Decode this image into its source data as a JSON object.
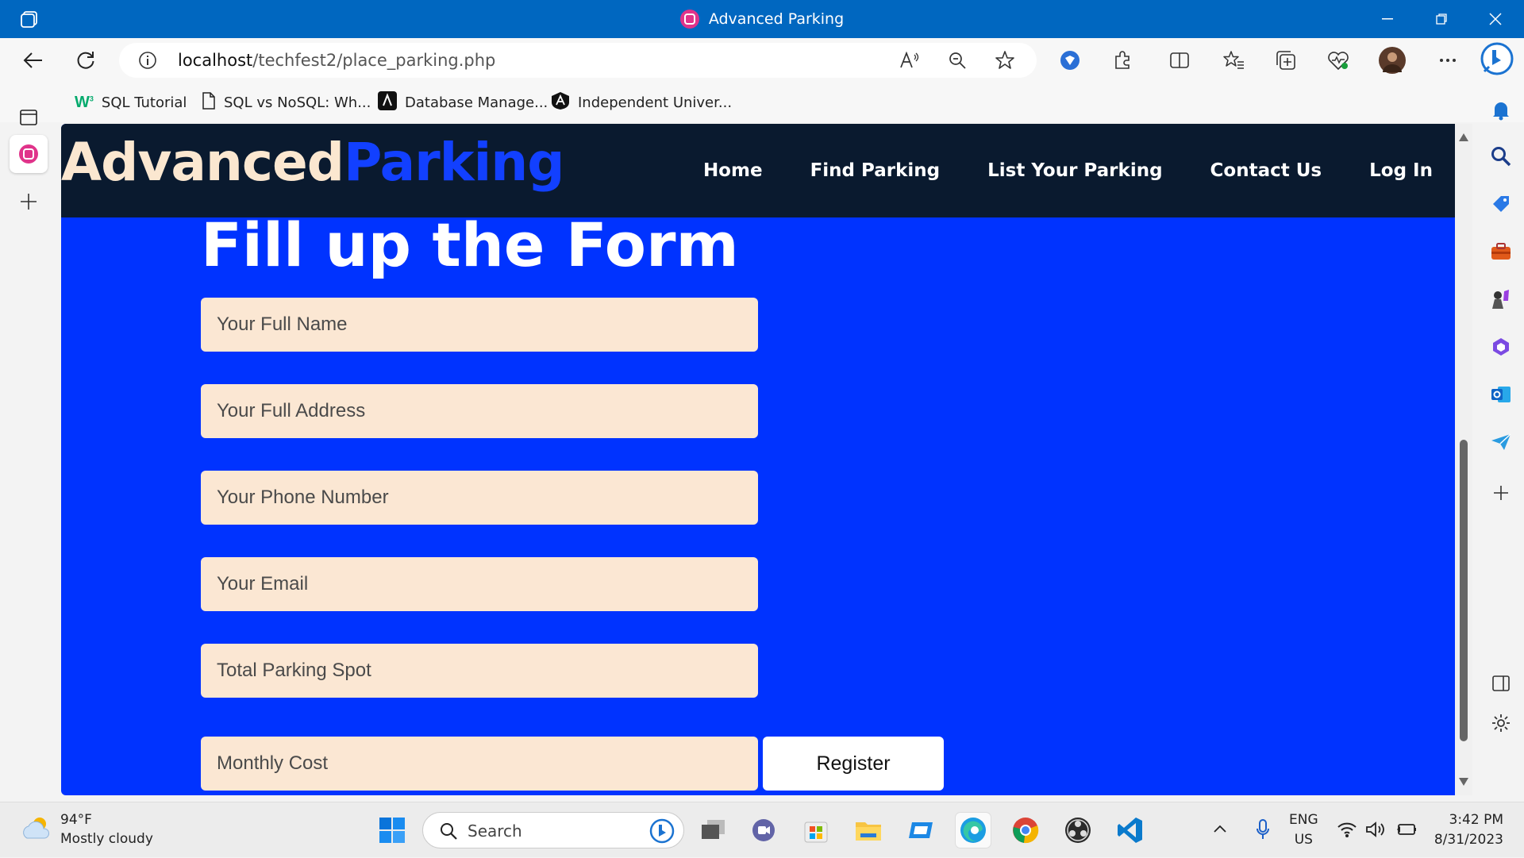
{
  "browser": {
    "window_title": "Advanced Parking",
    "url_host": "localhost",
    "url_path": "/techfest2/place_parking.php",
    "favorites": [
      {
        "label": "SQL Tutorial",
        "icon": "w3schools-icon"
      },
      {
        "label": "SQL vs NoSQL: Wh...",
        "icon": "page-icon"
      },
      {
        "label": "Database Manage...",
        "icon": "react-icon"
      },
      {
        "label": "Independent Univer...",
        "icon": "university-icon"
      }
    ]
  },
  "site": {
    "logo_part1": "Advanced",
    "logo_part2": "Parking",
    "nav": [
      "Home",
      "Find Parking",
      "List Your Parking",
      "Contact Us",
      "Log In"
    ],
    "form_title": "Fill up the Form",
    "fields": [
      {
        "name": "full-name-field",
        "placeholder": "Your Full Name"
      },
      {
        "name": "address-field",
        "placeholder": "Your Full Address"
      },
      {
        "name": "phone-field",
        "placeholder": "Your Phone Number"
      },
      {
        "name": "email-field",
        "placeholder": "Your Email"
      },
      {
        "name": "parking-spot-field",
        "placeholder": "Total Parking Spot"
      },
      {
        "name": "monthly-cost-field",
        "placeholder": "Monthly Cost"
      }
    ],
    "register_label": "Register",
    "colors": {
      "page_bg": "#0033ff",
      "header_bg": "#0a1a2f",
      "logo_accent": "#1240ff",
      "field_bg": "#fbe7d3"
    }
  },
  "taskbar": {
    "temperature": "94°F",
    "weather": "Mostly cloudy",
    "search_label": "Search",
    "lang_top": "ENG",
    "lang_bottom": "US",
    "time": "3:42 PM",
    "date": "8/31/2023"
  }
}
